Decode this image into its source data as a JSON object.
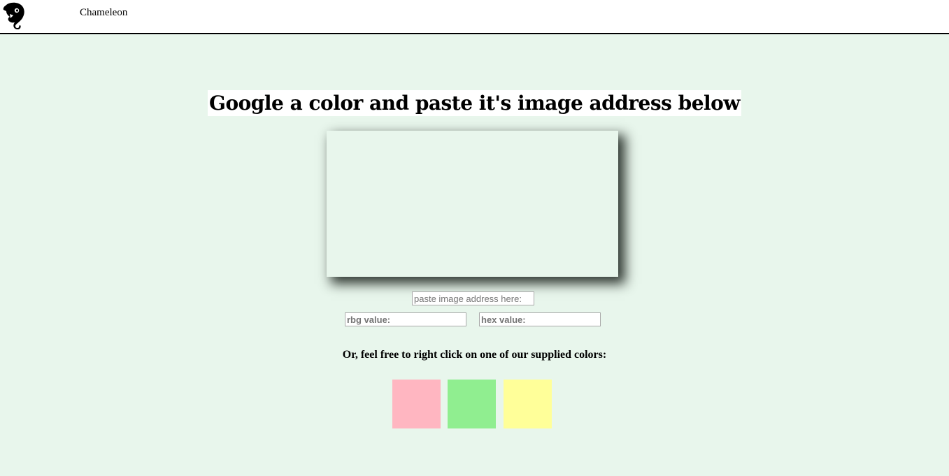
{
  "header": {
    "brand": "Chameleon",
    "logo_icon": "chameleon-icon"
  },
  "main": {
    "headline": "Google a color and paste it's image address below",
    "preview_color": "#e8f6ec",
    "url_input": {
      "placeholder": "paste image address here:",
      "value": ""
    },
    "rgb_input": {
      "placeholder": "rbg value:",
      "value": ""
    },
    "hex_input": {
      "placeholder": "hex value:",
      "value": ""
    },
    "subtext": "Or, feel free to right click on one of our supplied colors:",
    "swatches": [
      {
        "name": "pink",
        "color": "#ffb6c1"
      },
      {
        "name": "light-green",
        "color": "#90ee90"
      },
      {
        "name": "light-yellow",
        "color": "#ffff99"
      }
    ]
  },
  "colors": {
    "background": "#e8f6ec",
    "header_background": "#ffffff",
    "header_border": "#000000"
  }
}
